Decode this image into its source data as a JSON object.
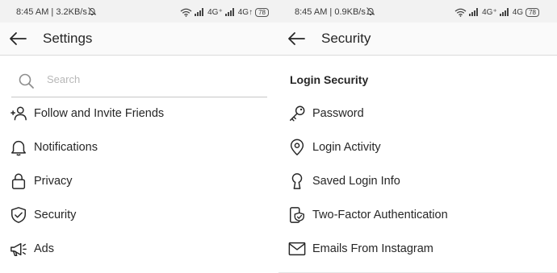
{
  "left": {
    "status": {
      "time": "8:45 AM | 3.2KB/s",
      "net1": "4G⁺",
      "net2": "4G↑",
      "battery": "78"
    },
    "header": {
      "title": "Settings"
    },
    "search": {
      "placeholder": "Search",
      "value": ""
    },
    "items": [
      {
        "label": "Follow and Invite Friends",
        "icon": "add-person-icon"
      },
      {
        "label": "Notifications",
        "icon": "bell-icon"
      },
      {
        "label": "Privacy",
        "icon": "lock-icon"
      },
      {
        "label": "Security",
        "icon": "shield-icon"
      },
      {
        "label": "Ads",
        "icon": "megaphone-icon"
      }
    ]
  },
  "right": {
    "status": {
      "time": "8:45 AM | 0.9KB/s",
      "net1": "4G⁺",
      "net2": "4G",
      "battery": "78"
    },
    "header": {
      "title": "Security"
    },
    "section_title": "Login Security",
    "items": [
      {
        "label": "Password",
        "icon": "key-icon"
      },
      {
        "label": "Login Activity",
        "icon": "location-pin-icon"
      },
      {
        "label": "Saved Login Info",
        "icon": "keyhole-icon"
      },
      {
        "label": "Two-Factor Authentication",
        "icon": "phone-shield-icon"
      },
      {
        "label": "Emails From Instagram",
        "icon": "envelope-icon"
      }
    ]
  }
}
